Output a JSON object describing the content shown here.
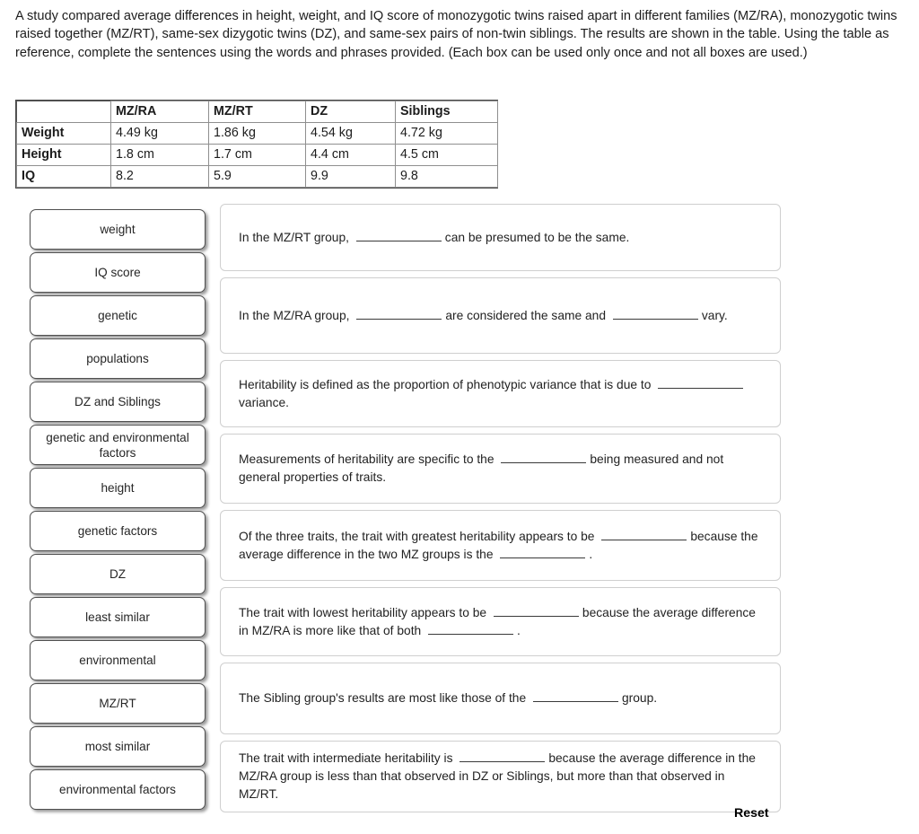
{
  "intro": {
    "text": "A study compared average differences in height, weight, and IQ score of monozygotic twins raised apart in different families (MZ/RA), monozygotic twins raised together (MZ/RT), same-sex dizygotic twins (DZ), and same-sex pairs of non-twin siblings. The results are shown in the table. Using the table as reference, complete the sentences using the words and phrases provided. (Each box can be used only once and not all boxes are used.)"
  },
  "table": {
    "corner_label": "",
    "columns": [
      "MZ/RA",
      "MZ/RT",
      "DZ",
      "Siblings"
    ],
    "rows": [
      {
        "label": "Weight",
        "values": [
          "4.49 kg",
          "1.86 kg",
          "4.54 kg",
          "4.72 kg"
        ]
      },
      {
        "label": "Height",
        "values": [
          "1.8 cm",
          "1.7 cm",
          "4.4 cm",
          "4.5 cm"
        ]
      },
      {
        "label": "IQ",
        "values": [
          "8.2",
          "5.9",
          "9.9",
          "9.8"
        ]
      }
    ]
  },
  "word_bank": {
    "items": [
      {
        "label": "weight"
      },
      {
        "label": "IQ score"
      },
      {
        "label": "genetic"
      },
      {
        "label": "populations"
      },
      {
        "label": "DZ and Siblings"
      },
      {
        "label": "genetic and environmental factors"
      },
      {
        "label": "height"
      },
      {
        "label": "genetic factors"
      },
      {
        "label": "DZ"
      },
      {
        "label": "least similar"
      },
      {
        "label": "environmental"
      },
      {
        "label": "MZ/RT"
      },
      {
        "label": "most similar"
      },
      {
        "label": "environmental factors"
      }
    ]
  },
  "sentences": [
    {
      "id": "sentence-1",
      "parts": [
        "In the MZ/RT group,",
        "BLANK",
        "can be presumed to be the same."
      ]
    },
    {
      "id": "sentence-2",
      "parts": [
        "In the MZ/RA group,",
        "BLANK",
        "are considered the same and",
        "BLANK",
        "vary."
      ]
    },
    {
      "id": "sentence-3",
      "parts": [
        "Heritability is defined as the proportion of phenotypic variance that is due to",
        "BLANK",
        "variance."
      ]
    },
    {
      "id": "sentence-4",
      "parts": [
        "Measurements of heritability are specific to the",
        "BLANK",
        "being measured and not general properties of traits."
      ]
    },
    {
      "id": "sentence-5",
      "parts": [
        "Of the three traits, the trait with greatest heritability appears to be",
        "BLANK",
        "because the average difference in the two MZ groups is the",
        "BLANK",
        "."
      ]
    },
    {
      "id": "sentence-6",
      "parts": [
        "The trait with lowest heritability appears to be",
        "BLANK",
        "because the average difference in MZ/RA is more like that of both",
        "BLANK",
        "."
      ]
    },
    {
      "id": "sentence-7",
      "parts": [
        "The Sibling group's results are most like those of the",
        "BLANK",
        "group."
      ]
    },
    {
      "id": "sentence-8",
      "parts": [
        "The trait with intermediate heritability is",
        "BLANK",
        "because the average difference in the MZ/RA group is less than that observed in DZ or Siblings, but more than that observed in MZ/RT."
      ]
    }
  ],
  "reset": {
    "label": "Reset"
  },
  "colors": {
    "text": "#1d1d1d",
    "table_border": "#8f8f8f",
    "chip_border": "#4f4f4f",
    "panel_border": "#cfcfcf",
    "blank_rule": "#3a3a3a"
  }
}
